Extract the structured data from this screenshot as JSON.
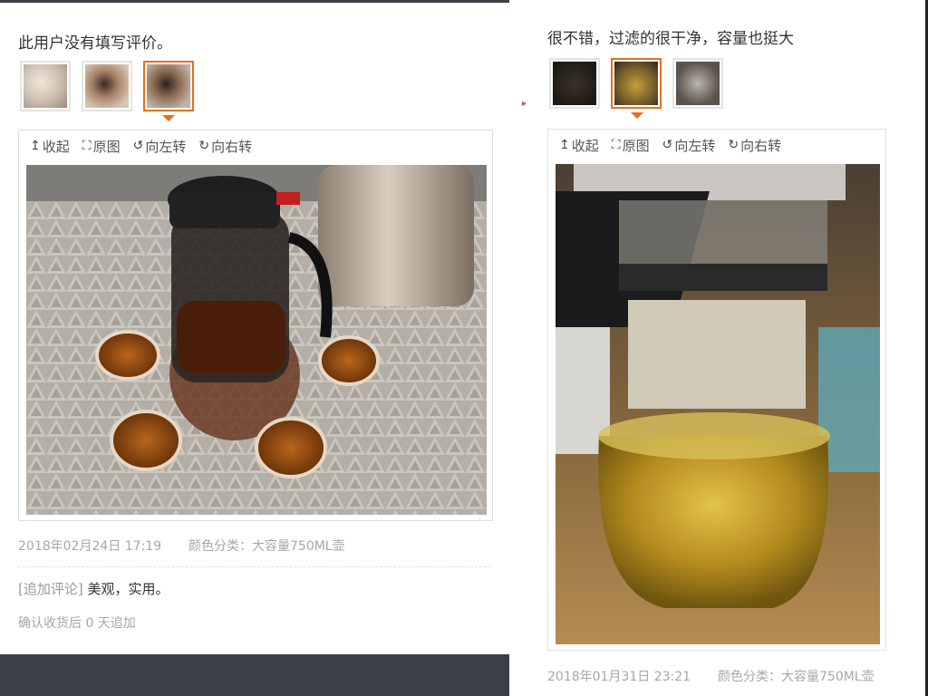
{
  "left_review": {
    "text": "此用户没有填写评价。",
    "toolbar": {
      "collapse": "收起",
      "original": "原图",
      "rotate_left": "向左转",
      "rotate_right": "向右转"
    },
    "date": "2018年02月24日 17:19",
    "sku": "颜色分类：大容量750ML壶",
    "append_tag": "[追加评论]",
    "append_text": "美观，实用。",
    "append_meta": "确认收货后 0 天追加"
  },
  "right_review": {
    "text": "很不错，过滤的很干净，容量也挺大",
    "toolbar": {
      "collapse": "收起",
      "original": "原图",
      "rotate_left": "向左转",
      "rotate_right": "向右转"
    },
    "date": "2018年01月31日 23:21",
    "sku": "颜色分类：大容量750ML壶"
  },
  "icons": {
    "collapse": "collapse-arrow-icon",
    "original": "expand-icon",
    "rotate_left": "rotate-left-icon",
    "rotate_right": "rotate-right-icon"
  },
  "colors": {
    "accent": "#e4701e",
    "meta_text": "#a7a7a7",
    "dark_bar": "#3c3f47"
  }
}
